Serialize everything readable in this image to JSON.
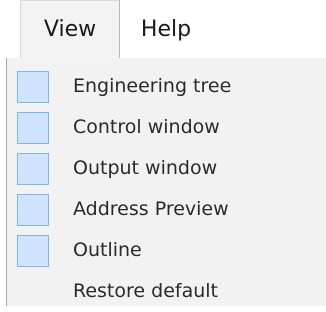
{
  "menubar": {
    "view_label": "View",
    "help_label": "Help"
  },
  "view_menu": {
    "items": [
      {
        "label": "Engineering tree",
        "checked": true
      },
      {
        "label": "Control window",
        "checked": true
      },
      {
        "label": "Output window",
        "checked": true
      },
      {
        "label": "Address Preview",
        "checked": true
      },
      {
        "label": "Outline",
        "checked": true
      },
      {
        "label": "Restore default",
        "checked": false
      }
    ]
  },
  "colors": {
    "check_fill": "#cfe3fc",
    "check_border": "#7fb4ee",
    "menu_background": "#f2f2f2",
    "active_menu_background": "#f3f3f3"
  }
}
